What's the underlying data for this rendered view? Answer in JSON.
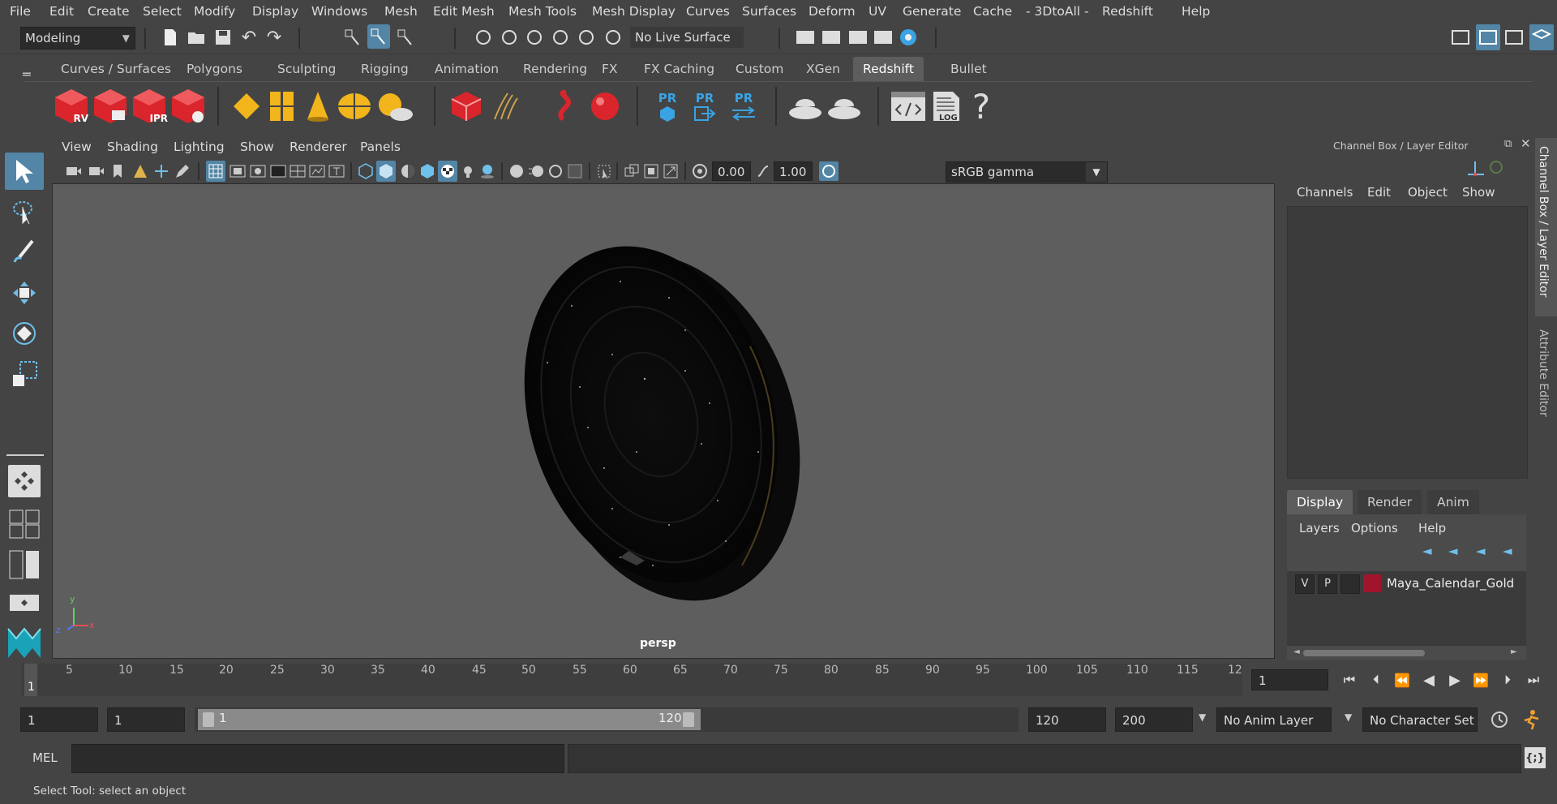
{
  "menubar": {
    "items": [
      "File",
      "Edit",
      "Create",
      "Select",
      "Modify",
      "Display",
      "Windows",
      "Mesh",
      "Edit Mesh",
      "Mesh Tools",
      "Mesh Display",
      "Curves",
      "Surfaces",
      "Deform",
      "UV",
      "Generate",
      "Cache",
      "- 3DtoAll -",
      "Redshift",
      "Help"
    ]
  },
  "statusline": {
    "mode": "Modeling",
    "live_surface": "No Live Surface"
  },
  "shelf": {
    "tabs": [
      "Curves / Surfaces",
      "Polygons",
      "Sculpting",
      "Rigging",
      "Animation",
      "Rendering",
      "FX",
      "FX Caching",
      "Custom",
      "XGen",
      "Redshift",
      "Bullet"
    ],
    "active_tab": "Redshift",
    "rv_label": "RV",
    "ipr_label": "IPR",
    "pr_label": "PR",
    "log_label": "LOG",
    "help_glyph": "?"
  },
  "viewport": {
    "menu": [
      "View",
      "Shading",
      "Lighting",
      "Show",
      "Renderer",
      "Panels"
    ],
    "exposure": "0.00",
    "gamma": "1.00",
    "colorspace": "sRGB gamma",
    "camera_label": "persp",
    "axis_x": "x",
    "axis_y": "y",
    "axis_z": "z"
  },
  "channel_box": {
    "title": "Channel Box / Layer Editor",
    "menu": [
      "Channels",
      "Edit",
      "Object",
      "Show"
    ],
    "side_tabs": [
      "Channel Box / Layer Editor",
      "Attribute Editor"
    ]
  },
  "layer_editor": {
    "tabs": [
      "Display",
      "Render",
      "Anim"
    ],
    "active_tab": "Display",
    "menu": [
      "Layers",
      "Options",
      "Help"
    ],
    "layers": [
      {
        "v": "V",
        "p": "P",
        "color": "#a0142c",
        "name": "Maya_Calendar_Gold"
      }
    ]
  },
  "timeline": {
    "ticks": [
      "1",
      "5",
      "10",
      "15",
      "20",
      "25",
      "30",
      "35",
      "40",
      "45",
      "50",
      "55",
      "60",
      "65",
      "70",
      "75",
      "80",
      "85",
      "90",
      "95",
      "100",
      "105",
      "110",
      "115",
      "12"
    ],
    "current_frame": "1"
  },
  "range": {
    "start": "1",
    "playback_start": "1",
    "slider_start": "1",
    "slider_end": "120",
    "playback_end": "120",
    "end": "200",
    "anim_layer": "No Anim Layer",
    "character_set": "No Character Set"
  },
  "command_line": {
    "label": "MEL",
    "value": ""
  },
  "help_line": {
    "text": "Select Tool: select an object"
  },
  "colors": {
    "accent": "#5285a6",
    "redshift_red": "#d9252b",
    "gold": "#f2b51c",
    "pr_blue": "#3aa3e3"
  }
}
